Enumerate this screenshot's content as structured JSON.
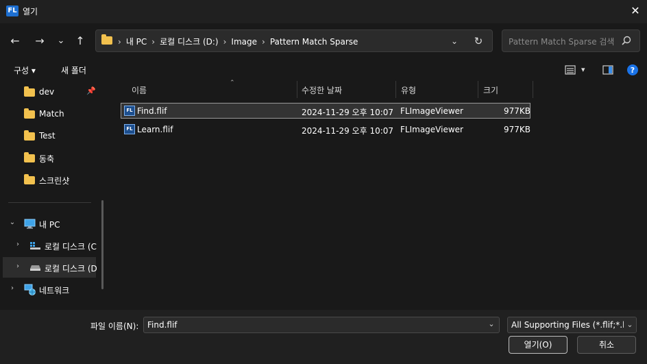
{
  "window": {
    "app_icon_text": "FL",
    "title": "열기",
    "close_glyph": "✕"
  },
  "nav": {
    "back_glyph": "←",
    "forward_glyph": "→",
    "recent_glyph": "⌄",
    "up_glyph": "↑",
    "breadcrumb": [
      "내 PC",
      "로컬 디스크 (D:)",
      "Image",
      "Pattern Match Sparse"
    ],
    "breadcrumb_sep": "›",
    "address_dropdown_glyph": "⌄",
    "refresh_glyph": "↻",
    "search_placeholder": "Pattern Match Sparse 검색"
  },
  "toolbar": {
    "organize_label": "구성 ▾",
    "new_folder_label": "새 폴더",
    "view_menu_glyph": "▾"
  },
  "sidebar": {
    "quick_access": [
      {
        "label": "dev",
        "pinned": true
      },
      {
        "label": "Match"
      },
      {
        "label": "Test"
      },
      {
        "label": "동축"
      },
      {
        "label": "스크린샷"
      }
    ],
    "pin_glyph": "📌",
    "tree": [
      {
        "label": "내 PC",
        "icon": "monitor-icon",
        "expander": "⌄"
      },
      {
        "label": "로컬 디스크 (C",
        "icon": "windows-drive-icon",
        "expander": "›"
      },
      {
        "label": "로컬 디스크 (D",
        "icon": "drive-icon",
        "expander": "›",
        "selected": true
      },
      {
        "label": "네트워크",
        "icon": "network-icon",
        "expander": "›"
      }
    ]
  },
  "columns": {
    "name": "이름",
    "date": "수정한 날짜",
    "type": "유형",
    "size": "크기"
  },
  "sort_glyph": "⌃",
  "files": [
    {
      "name": "Find.flif",
      "date": "2024-11-29 오후 10:07",
      "type": "FLImageViewer",
      "size": "977KB",
      "icon_text": "FL",
      "selected": true
    },
    {
      "name": "Learn.flif",
      "date": "2024-11-29 오후 10:07",
      "type": "FLImageViewer",
      "size": "977KB",
      "icon_text": "FL"
    }
  ],
  "bottom": {
    "filename_label": "파일 이름(N):",
    "filename_value": "Find.flif",
    "dropdown_glyph": "⌄",
    "filter_value": "All Supporting Files (*.flif;*.bm",
    "open_label": "열기(O)",
    "cancel_label": "취소"
  },
  "colors": {
    "folder": "#f2c14e",
    "accent": "#1d6fd1",
    "help": "#1a73e8"
  }
}
